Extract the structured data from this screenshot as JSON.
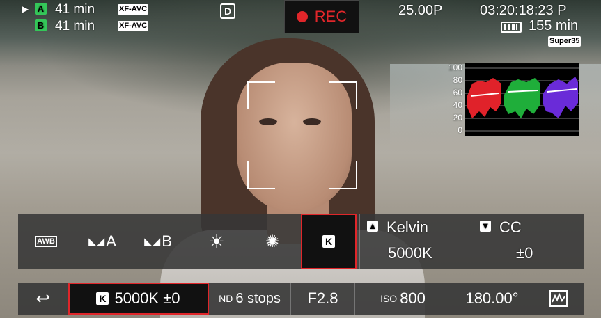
{
  "status": {
    "slot_a": {
      "letter": "A",
      "time": "41 min",
      "format": "XF-AVC"
    },
    "slot_b": {
      "letter": "B",
      "time": "41 min",
      "format": "XF-AVC"
    },
    "rec_label": "REC",
    "frame_rate": "25.00P",
    "timecode": "03:20:18:23 P",
    "battery": "155 min",
    "sensor_mode": "Super35",
    "play_arrow": "▶",
    "drive_icon": "D"
  },
  "waveform": {
    "scale": [
      "100",
      "80",
      "60",
      "40",
      "20",
      "0"
    ],
    "colors": {
      "red": "#e0222a",
      "green": "#1fae3a",
      "blue": "#6a2bd8"
    }
  },
  "wb_panel": {
    "options": [
      {
        "label": "AWB",
        "icon": "awb-icon"
      },
      {
        "label": "A",
        "icon": "set-a-icon"
      },
      {
        "label": "B",
        "icon": "set-b-icon"
      },
      {
        "label": "",
        "icon": "daylight-icon"
      },
      {
        "label": "",
        "icon": "tungsten-icon"
      },
      {
        "label": "K",
        "icon": "kelvin-icon",
        "selected": true
      }
    ],
    "kelvin": {
      "title": "Kelvin",
      "value": "5000K"
    },
    "cc": {
      "title": "CC",
      "value": "±0"
    }
  },
  "bottom_bar": {
    "back_icon": "return-icon",
    "wb_value": "5000K ±0",
    "wb_badge": "K",
    "nd_prefix": "ND",
    "nd_value": "6 stops",
    "aperture": "F2.8",
    "iso_prefix": "ISO",
    "iso_value": "800",
    "shutter": "180.00°",
    "waveform_toggle_icon": "waveform-icon"
  },
  "accent_colors": {
    "record": "#e0262a",
    "selection": "#e0262a",
    "slot": "#34c759"
  }
}
